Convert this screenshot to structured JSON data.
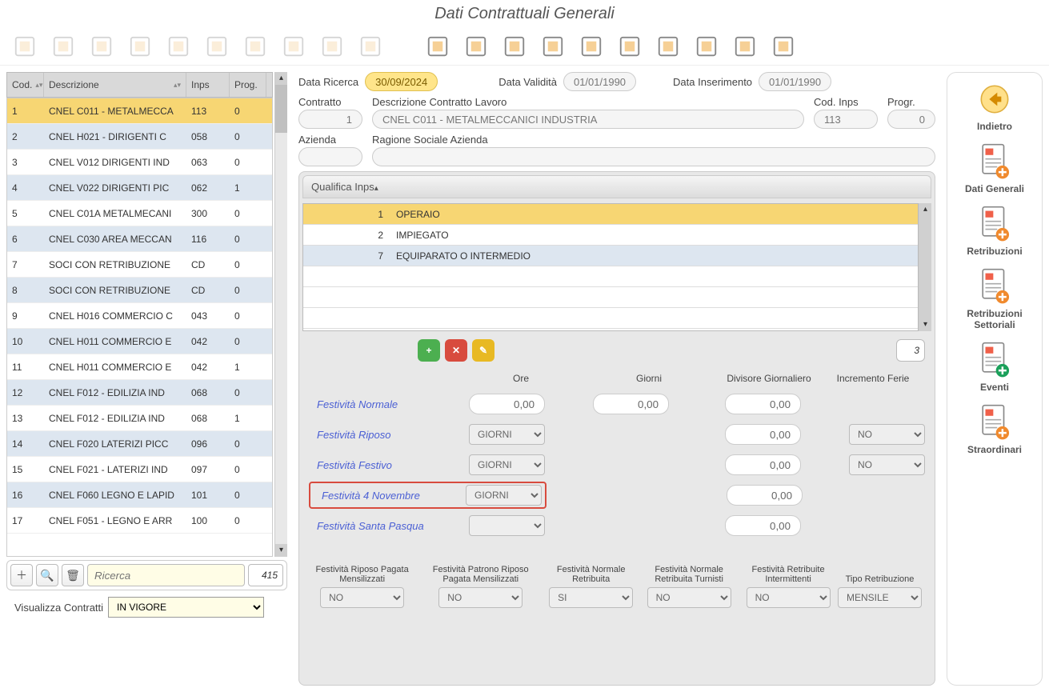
{
  "title": "Dati Contrattuali Generali",
  "toolbar_icons": [
    "user-student",
    "bank",
    "form-edit",
    "form-add",
    "cancel-circle",
    "trash",
    "doc1",
    "doc2",
    "doc3",
    "zoom",
    "target",
    "docs-stack",
    "cards",
    "books",
    "clock",
    "printer",
    "person",
    "display-chart",
    "cloud-down",
    "exit"
  ],
  "left": {
    "headers": {
      "cod": "Cod.",
      "desc": "Descrizione",
      "inps": "Inps",
      "prog": "Prog."
    },
    "rows": [
      {
        "cod": "1",
        "desc": "CNEL C011 - METALMECCA",
        "inps": "113",
        "prog": "0"
      },
      {
        "cod": "2",
        "desc": "CNEL H021 - DIRIGENTI C",
        "inps": "058",
        "prog": "0"
      },
      {
        "cod": "3",
        "desc": "CNEL V012 DIRIGENTI IND",
        "inps": "063",
        "prog": "0"
      },
      {
        "cod": "4",
        "desc": "CNEL V022 DIRIGENTI PIC",
        "inps": "062",
        "prog": "1"
      },
      {
        "cod": "5",
        "desc": "CNEL C01A METALMECANI",
        "inps": "300",
        "prog": "0"
      },
      {
        "cod": "6",
        "desc": "CNEL C030 AREA MECCAN",
        "inps": "116",
        "prog": "0"
      },
      {
        "cod": "7",
        "desc": "SOCI CON RETRIBUZIONE",
        "inps": "CD",
        "prog": "0"
      },
      {
        "cod": "8",
        "desc": "SOCI CON RETRIBUZIONE",
        "inps": "CD",
        "prog": "0"
      },
      {
        "cod": "9",
        "desc": "CNEL H016 COMMERCIO C",
        "inps": "043",
        "prog": "0"
      },
      {
        "cod": "10",
        "desc": "CNEL H011 COMMERCIO E",
        "inps": "042",
        "prog": "0"
      },
      {
        "cod": "11",
        "desc": "CNEL H011 COMMERCIO E",
        "inps": "042",
        "prog": "1"
      },
      {
        "cod": "12",
        "desc": "CNEL F012 - EDILIZIA IND",
        "inps": "068",
        "prog": "0"
      },
      {
        "cod": "13",
        "desc": "CNEL F012 - EDILIZIA IND",
        "inps": "068",
        "prog": "1"
      },
      {
        "cod": "14",
        "desc": "CNEL F020 LATERIZI PICC",
        "inps": "096",
        "prog": "0"
      },
      {
        "cod": "15",
        "desc": "CNEL F021 - LATERIZI IND",
        "inps": "097",
        "prog": "0"
      },
      {
        "cod": "16",
        "desc": "CNEL F060 LEGNO E LAPID",
        "inps": "101",
        "prog": "0"
      },
      {
        "cod": "17",
        "desc": "CNEL F051 - LEGNO E ARR",
        "inps": "100",
        "prog": "0"
      }
    ],
    "search_placeholder": "Ricerca",
    "count": "415",
    "vis_label": "Visualizza Contratti",
    "vis_value": "IN VIGORE"
  },
  "header_form": {
    "data_ricerca_lbl": "Data Ricerca",
    "data_ricerca": "30/09/2024",
    "data_validita_lbl": "Data Validità",
    "data_validita": "01/01/1990",
    "data_inserimento_lbl": "Data Inserimento",
    "data_inserimento": "01/01/1990",
    "contratto_lbl": "Contratto",
    "contratto_val": "1",
    "desc_contratto_lbl": "Descrizione Contratto Lavoro",
    "desc_contratto_val": "CNEL C011 - METALMECCANICI INDUSTRIA",
    "cod_inps_lbl": "Cod. Inps",
    "cod_inps_val": "113",
    "progr_lbl": "Progr.",
    "progr_val": "0",
    "azienda_lbl": "Azienda",
    "azienda_val": "",
    "ragsoc_lbl": "Ragione Sociale Azienda",
    "ragsoc_val": ""
  },
  "panel": {
    "header": "Qualifica Inps",
    "rows": [
      {
        "n": "1",
        "d": "OPERAIO"
      },
      {
        "n": "2",
        "d": "IMPIEGATO"
      },
      {
        "n": "7",
        "d": "EQUIPARATO O INTERMEDIO"
      }
    ],
    "count": "3",
    "fest_headers": {
      "ore": "Ore",
      "giorni": "Giorni",
      "div": "Divisore Giornaliero",
      "inc": "Incremento Ferie"
    },
    "fest": [
      {
        "label": "Festività Normale",
        "ore": "0,00",
        "giorni": "0,00",
        "div": "0,00"
      },
      {
        "label": "Festività Riposo",
        "sel": "GIORNI",
        "div": "0,00",
        "inc": "NO"
      },
      {
        "label": "Festività Festivo",
        "sel": "GIORNI",
        "div": "0,00",
        "inc": "NO"
      },
      {
        "label": "Festività 4 Novembre",
        "sel": "GIORNI",
        "div": "0,00"
      },
      {
        "label": "Festività Santa Pasqua",
        "sel": "",
        "div": "0,00"
      }
    ],
    "bottom": [
      {
        "label": "Festività Riposo Pagata Mensilizzati",
        "val": "NO"
      },
      {
        "label": "Festività Patrono Riposo Pagata Mensilizzati",
        "val": "NO"
      },
      {
        "label": "Festività Normale Retribuita",
        "val": "SI"
      },
      {
        "label": "Festività Normale Retribuita Turnisti",
        "val": "NO"
      },
      {
        "label": "Festività Retribuite Intermittenti",
        "val": "NO"
      },
      {
        "label": "Tipo Retribuzione",
        "val": "MENSILE"
      }
    ]
  },
  "right_nav": [
    {
      "label": "Indietro",
      "type": "back"
    },
    {
      "label": "Dati Generali",
      "type": "doc"
    },
    {
      "label": "Retribuzioni",
      "type": "doc"
    },
    {
      "label": "Retribuzioni Settoriali",
      "type": "doc"
    },
    {
      "label": "Eventi",
      "type": "doc-green"
    },
    {
      "label": "Straordinari",
      "type": "doc"
    }
  ]
}
